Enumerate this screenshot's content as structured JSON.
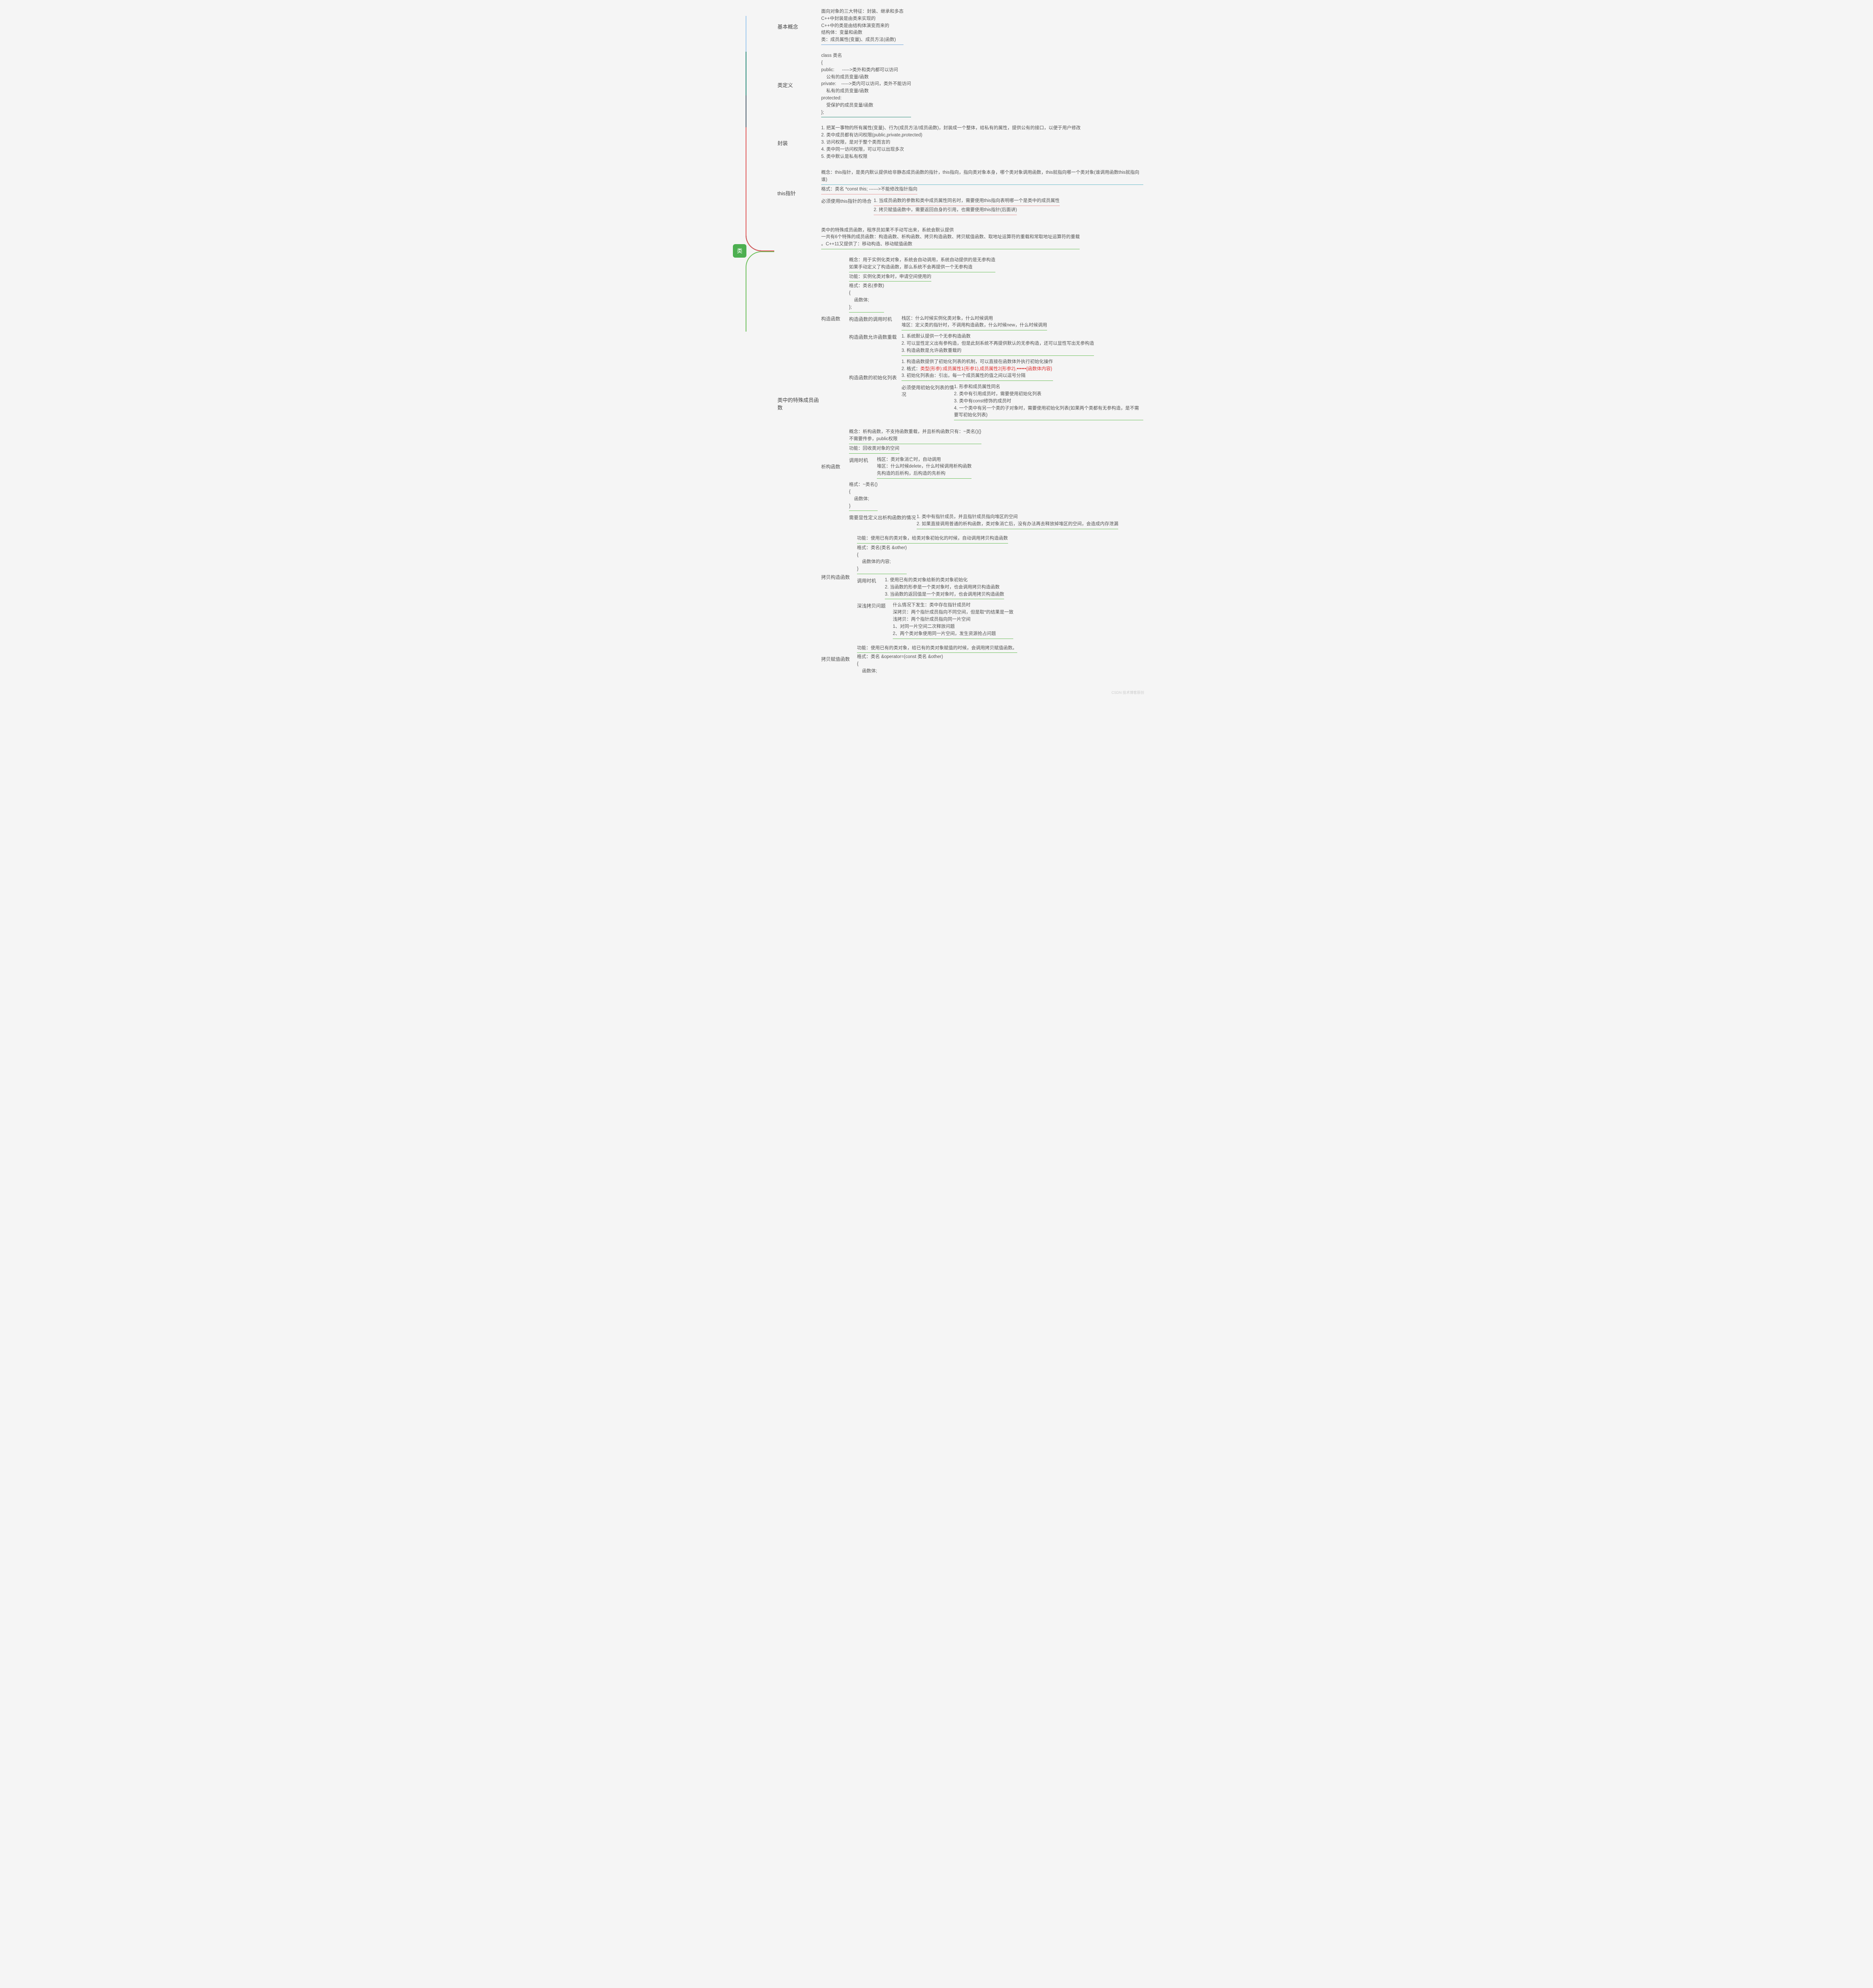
{
  "root": "类",
  "watermark": "CSDN 技术博客原创",
  "branches": {
    "basic": {
      "label": "基本概念",
      "lines": [
        "面向对象的三大特征：封装、继承和多态",
        "C++中封装是由类来实现的",
        "C++中的类是由结构体演变而来的",
        "结构体：变量和函数",
        "类：成员属性(变量)、成员方法(函数)"
      ]
    },
    "def": {
      "label": "类定义",
      "lines": [
        "class 类名",
        "{",
        "public:      ----->类外和类内都可以访问",
        "    公有的成员变量/函数",
        "private:    ----->类内可以访问，类外不能访问",
        "    私有的成员变量/函数",
        "protected:",
        "    受保护的成员变量/函数",
        "};"
      ]
    },
    "encap": {
      "label": "封装",
      "lines": [
        "1. 把某一事物的所有属性(变量)、行为(成员方法/成员函数)，封装成一个整体，给私有的属性，提供公有的接口，以便于用户修改",
        "2. 类中成员都有访问权限(public,private,protected)",
        "3. 访问权限，是对于整个类而言的",
        "4. 类中同一访问权限，可以可以出现多次",
        "5. 类中默认是私有权限"
      ]
    },
    "thisptr": {
      "label": "this指针",
      "concept": "概念：this指针，是类内默认提供给非静态成员函数的指针，this指向，指向类对象本身，哪个类对象调用函数，this就指向哪一个类对象(谁调用函数this就指向谁)",
      "format": "格式：类名 *const this;  ------>不能修改指针指向",
      "must_label": "必须使用this指针的场合",
      "must_items": [
        "1. 当成员函数的参数和类中成员属性同名时，需要使用this指向表明哪一个是类中的成员属性",
        "2. 拷贝赋值函数中，需要返回自身的引用，也需要使用this指针(后面讲)"
      ]
    },
    "special": {
      "label": "类中的特殊成员函数",
      "intro": [
        "类中的特殊成员函数，程序员如果不手动写出来，系统会默认提供",
        "一共有6个特殊的成员函数：构造函数、析构函数、拷贝构造函数、拷贝赋值函数、取地址运算符的重载和常取地址运算符的重载",
        "。C++11又提供了：移动构造、移动赋值函数"
      ],
      "ctor": {
        "label": "构造函数",
        "concept": [
          "概念：用于实例化类对象，系统会自动调用，系统自动提供的是无参构造",
          "如果手动定义了构造函数，那么系统不会再提供一个无参构造"
        ],
        "func": "功能：实例化类对象时，申请空间使用的",
        "format": [
          "格式：类名(参数)",
          "{",
          "    函数体;",
          "};"
        ],
        "timing_label": "构造函数的调用时机",
        "timing": [
          "栈区：什么时候实例化类对象，什么时候调用",
          "堆区：定义类的指针时，不调用构造函数，什么时候new，什么时候调用"
        ],
        "overload_label": "构造函数允许函数重载",
        "overload": [
          "1. 系统默认提供一个无参构造函数",
          "2. 可以显性定义出有参构造，但是此刻系统不再提供默认的无参构造，还可以显性写出无参构造",
          "3. 构造函数是允许函数重载的"
        ],
        "initlist_label": "构造函数的初始化列表",
        "initlist": [
          "1. 构造函数提供了初始化列表的机制，可以直接在函数体外执行初始化操作",
          "2. 格式：",
          "3. 初始化列表由：引出，每一个成员属性的值之间以逗号分隔"
        ],
        "initlist_format_red": "类型(形参):成员属性1(形参1),成员属性2(形参2),••••••{函数体内容}",
        "initlist_must_label": "必须使用初始化列表的情况",
        "initlist_must": [
          "1. 形参和成员属性同名",
          "2. 类中有引用成员时，需要使用初始化列表",
          "3. 类中有const修饰的成员时",
          "4. 一个类中有另一个类的子对象时，需要使用初始化列表(如果两个类都有无参构造，是不需要写初始化列表)"
        ]
      },
      "dtor": {
        "label": "析构函数",
        "concept": [
          "概念：析构函数，不支持函数重载，并且析构函数只有：~类名(){}",
          "不需要传参，public权限"
        ],
        "func": "功能：回收类对象的空间",
        "timing_label": "调用时机",
        "timing": [
          "栈区：类对象消亡时，自动调用",
          "堆区：什么时候delete，什么时候调用析构函数",
          "先构造的后析构，后构造的先析构"
        ],
        "format": [
          "格式：~类名()",
          "{",
          "    函数体;",
          "}"
        ],
        "need_label": "需要显性定义出析构函数的情况",
        "need": [
          "1. 类中有指针成员，并且指针成员指向堆区的空间",
          "2. 如果直接调用普通的析构函数，类对象消亡后，没有办法再去释放掉堆区的空间，会造成内存泄漏"
        ]
      },
      "copy_ctor": {
        "label": "拷贝构造函数",
        "func": "功能：使用已有的类对象，给类对象初始化的时候，自动调用拷贝构造函数",
        "format": [
          "格式：类名(类名 &other)",
          "{",
          "    函数体的内容;",
          "}"
        ],
        "timing_label": "调用时机",
        "timing": [
          "1. 使用已有的类对象给新的类对象初始化",
          "2. 当函数的形参是一个类对象时，也会调用拷贝构造函数",
          "3. 当函数的返回值是一个类对象时，也会调用拷贝构造函数"
        ],
        "deep_label": "深浅拷贝问题",
        "deep": [
          "什么情况下发生：类中存在指针成员时",
          "深拷贝：两个指针成员指向不同空间，但是取*的结果是一致",
          "浅拷贝：两个指针成员指向同一片空间",
          "1、对同一片空间二次释放问题",
          "2、两个类对象使用同一片空间，发生资源抢占问题"
        ]
      },
      "copy_assign": {
        "label": "拷贝赋值函数",
        "func": "功能：使用已有的类对象，给已有的类对象赋值的时候，会调用拷贝赋值函数。",
        "format": [
          "格式：类名 &operator=(const 类名 &other)",
          "{",
          "    函数体;"
        ]
      }
    }
  }
}
